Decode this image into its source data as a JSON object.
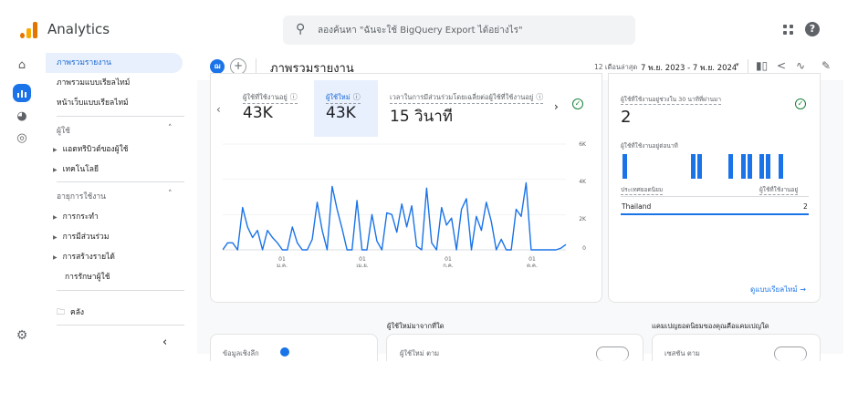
{
  "app": {
    "title": "Analytics"
  },
  "search": {
    "placeholder": "ลองค้นหา \"ฉันจะใช้ BigQuery Export ได้อย่างไร\""
  },
  "icons": {
    "search": "search-icon",
    "apps": "apps-grid-icon",
    "help": "help-icon",
    "home": "home-icon",
    "reports": "reports-icon",
    "explore": "explore-icon",
    "advertising": "advertising-icon",
    "settings": "gear-icon",
    "library": "folder-icon"
  },
  "nav": {
    "items": [
      {
        "label": "ภาพรวมรายงาน",
        "active": true
      },
      {
        "label": "ภาพรวมแบบเรียลไทม์",
        "active": false
      },
      {
        "label": "หน้าเว็บแบบเรียลไทม์",
        "active": false
      }
    ],
    "sections": [
      {
        "title": "ผู้ใช้",
        "children": [
          "แอตทริบิวต์ของผู้ใช้",
          "เทคโนโลยี"
        ]
      },
      {
        "title": "อายุการใช้งาน",
        "children": [
          "การกระทำ",
          "การมีส่วนร่วม",
          "การสร้างรายได้",
          "การรักษาผู้ใช้"
        ]
      }
    ],
    "library": "คลัง",
    "collapse": "‹"
  },
  "header": {
    "avatar_letter": "ฌ",
    "add_label": "+",
    "page_title": "ภาพรวมรายงาน",
    "date_label": "12 เดือนล่าสุด",
    "date_range": "7 พ.ย. 2023 - 7 พ.ย. 2024",
    "date_caret": "▾"
  },
  "metrics": [
    {
      "label": "ผู้ใช้ที่ใช้งานอยู่",
      "value": "43K",
      "selected": false
    },
    {
      "label": "ผู้ใช้ใหม่",
      "value": "43K",
      "selected": true
    },
    {
      "label": "เวลาในการมีส่วนร่วมโดยเฉลี่ยต่อผู้ใช้ที่ใช้งานอยู่",
      "value": "15 วินาที",
      "selected": false
    }
  ],
  "chart_data": {
    "type": "line",
    "y_ticks": [
      "6K",
      "4K",
      "2K",
      "0"
    ],
    "ylim": [
      0,
      6000
    ],
    "x_ticks": [
      {
        "day": "01",
        "month": "ม.ค."
      },
      {
        "day": "01",
        "month": "เม.ย."
      },
      {
        "day": "01",
        "month": "ก.ค."
      },
      {
        "day": "01",
        "month": "ต.ค."
      }
    ],
    "series": [
      {
        "color": "#1a73e8",
        "values": [
          0,
          400,
          400,
          0,
          2400,
          1300,
          700,
          1100,
          0,
          1100,
          700,
          400,
          0,
          0,
          1300,
          400,
          0,
          0,
          600,
          2700,
          1100,
          0,
          3600,
          2300,
          1200,
          0,
          0,
          2800,
          0,
          0,
          2000,
          500,
          0,
          2100,
          2000,
          1000,
          2600,
          1300,
          2500,
          200,
          0,
          3500,
          400,
          0,
          2400,
          1400,
          1800,
          0,
          2300,
          2900,
          0,
          1900,
          1100,
          2700,
          1600,
          0,
          600,
          0,
          0,
          2300,
          1900,
          3800,
          0,
          0,
          0,
          0,
          0,
          0,
          100,
          300
        ]
      }
    ]
  },
  "realtime": {
    "title": "ผู้ใช้ที่ใช้งานอยู่ช่วงใน 30 นาทีที่ผ่านมา",
    "value": "2",
    "per_minute_label": "ผู้ใช้ที่ใช้งานอยู่ต่อนาที",
    "bars": [
      1,
      0,
      0,
      0,
      0,
      0,
      0,
      0,
      0,
      0,
      0,
      1,
      1,
      0,
      0,
      0,
      0,
      1,
      0,
      1,
      1,
      0,
      1,
      1,
      0,
      1,
      0,
      0,
      0,
      0
    ],
    "table_headers": [
      "ประเทศยอดนิยม",
      "ผู้ใช้ที่ใช้งานอยู่"
    ],
    "rows": [
      {
        "country": "Thailand",
        "users": "2"
      }
    ],
    "link": "ดูแบบเรียลไทม์ →"
  },
  "bottom": {
    "section_new_users": "ผู้ใช้ใหม่มาจากที่ใด",
    "section_campaigns": "แคมเปญยอดนิยมของคุณคือแคมเปญใด",
    "card1_text": "ข้อมูลเชิงลึก",
    "card2_text": "ผู้ใช้ใหม่ ตาม",
    "card3_text": "เซสชัน ตาม"
  }
}
